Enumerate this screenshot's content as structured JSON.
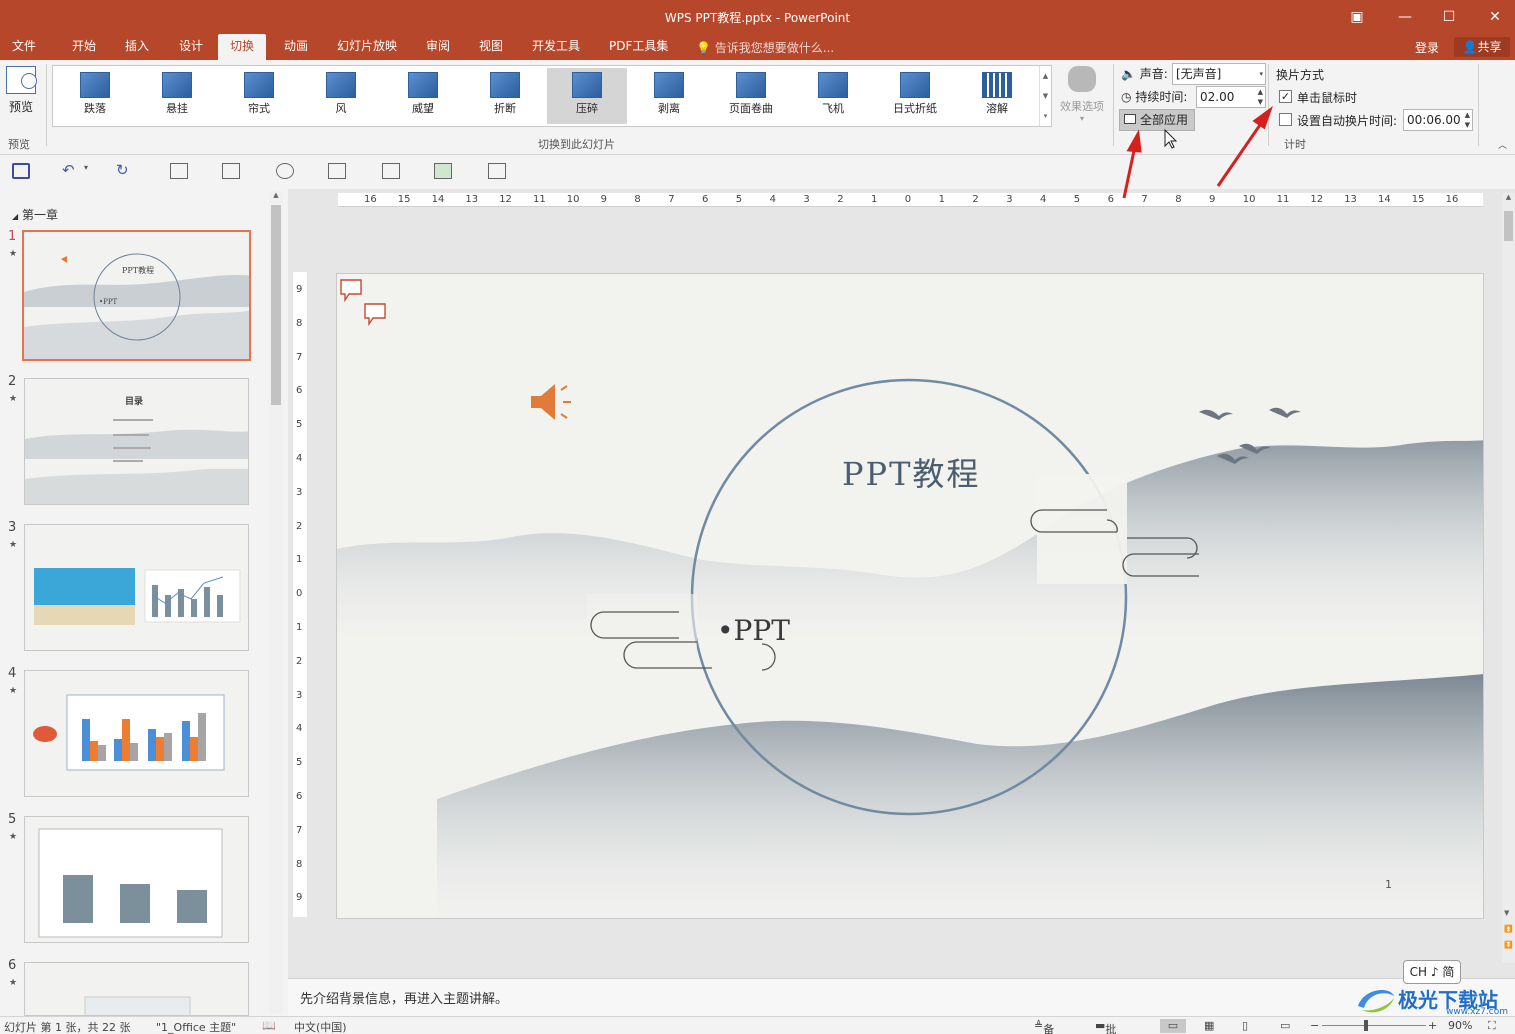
{
  "window": {
    "title": "WPS PPT教程.pptx - PowerPoint"
  },
  "menu": {
    "tabs": [
      "文件",
      "开始",
      "插入",
      "设计",
      "切换",
      "动画",
      "幻灯片放映",
      "审阅",
      "视图",
      "开发工具",
      "PDF工具集"
    ],
    "active_tab": "切换",
    "tell_me": "告诉我您想要做什么...",
    "login": "登录",
    "share": "共享"
  },
  "ribbon": {
    "preview_label": "预览",
    "preview_group": "预览",
    "transitions": [
      "跌落",
      "悬挂",
      "帘式",
      "风",
      "威望",
      "折断",
      "压碎",
      "剥离",
      "页面卷曲",
      "飞机",
      "日式折纸",
      "溶解"
    ],
    "selected_transition": "压碎",
    "transition_group": "切换到此幻灯片",
    "effect_options": "效果选项",
    "sound_label": "声音:",
    "sound_value": "[无声音]",
    "duration_label": "持续时间:",
    "duration_value": "02.00",
    "apply_all": "全部应用",
    "advance_title": "换片方式",
    "on_click_label": "单击鼠标时",
    "on_click_checked": true,
    "auto_after_label": "设置自动换片时间:",
    "auto_after_checked": false,
    "auto_after_value": "00:06.00",
    "timing_group": "计时"
  },
  "slides_pane": {
    "section": "第一章",
    "slides": [
      {
        "num": "1",
        "title": "PPT教程",
        "sub": "•PPT"
      },
      {
        "num": "2",
        "title": "目录"
      },
      {
        "num": "3"
      },
      {
        "num": "4"
      },
      {
        "num": "5"
      },
      {
        "num": "6"
      }
    ],
    "selected": "1"
  },
  "ruler": {
    "horizontal": [
      "16",
      "15",
      "14",
      "13",
      "12",
      "11",
      "10",
      "9",
      "8",
      "7",
      "6",
      "5",
      "4",
      "3",
      "2",
      "1",
      "0",
      "1",
      "2",
      "3",
      "4",
      "5",
      "6",
      "7",
      "8",
      "9",
      "10",
      "11",
      "12",
      "13",
      "14",
      "15",
      "16"
    ],
    "vertical": [
      "9",
      "8",
      "7",
      "6",
      "5",
      "4",
      "3",
      "2",
      "1",
      "0",
      "1",
      "2",
      "3",
      "4",
      "5",
      "6",
      "7",
      "8",
      "9"
    ]
  },
  "slide": {
    "title": "PPT教程",
    "subtitle": "•PPT",
    "page_number": "1"
  },
  "notes": {
    "text": "先介绍背景信息，再进入主题讲解。"
  },
  "ime": "CH ♪ 简",
  "watermark": {
    "text": "极光下载站",
    "sub": "www.xz7.com"
  },
  "status": {
    "slide_info": "幻灯片 第 1 张，共 22 张",
    "theme": "\"1_Office 主题\"",
    "language": "中文(中国)",
    "notes": "备注",
    "comments": "批注",
    "zoom": "90%"
  },
  "colors": {
    "accent": "#b7472a",
    "arrow": "#d62020",
    "slide_title": "#4b5e6f"
  }
}
